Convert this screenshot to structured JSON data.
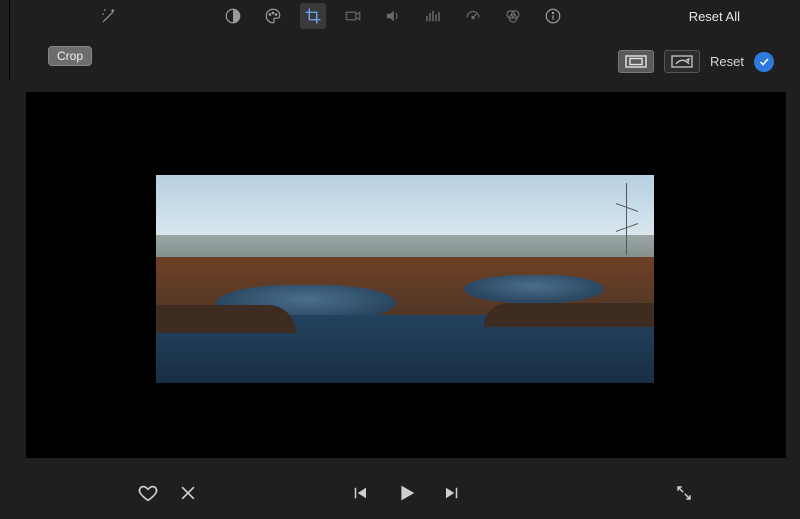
{
  "toolbar": {
    "wand": "auto-enhance-icon",
    "items": [
      "color-balance",
      "color-palette",
      "crop",
      "stabilize",
      "audio",
      "equalizer",
      "speed",
      "color-filter",
      "info"
    ],
    "active_index": 2,
    "reset_all_label": "Reset All"
  },
  "crop_tooltip": "Crop",
  "crop_controls": {
    "fit_mode": "fit",
    "reset_label": "Reset"
  },
  "playback": {
    "favorite": "favorite",
    "reject": "reject",
    "prev": "previous-frame",
    "play": "play",
    "next": "next-frame",
    "fullscreen": "fullscreen"
  }
}
